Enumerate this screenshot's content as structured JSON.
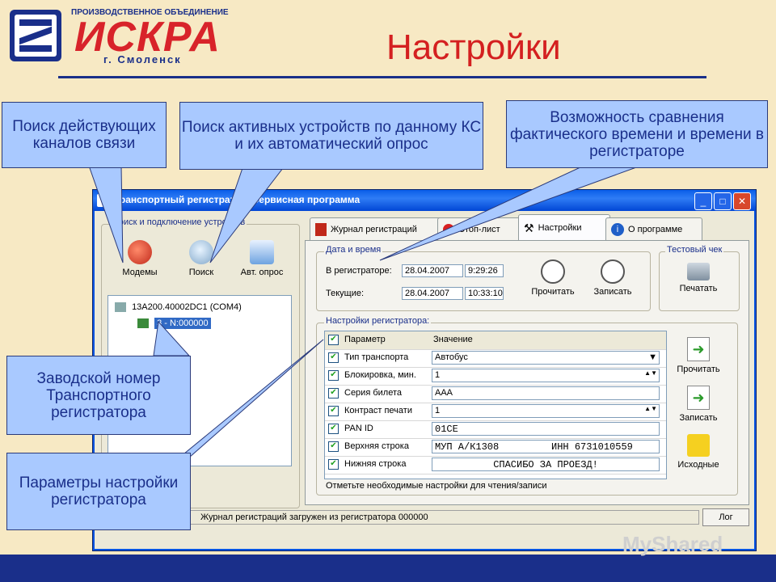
{
  "header": {
    "brand_top": "ПРОИЗВОДСТВЕННОЕ ОБЪЕДИНЕНИЕ",
    "brand": "ИСКРА",
    "brand_city": "г. Смоленск",
    "page_title": "Настройки"
  },
  "callouts": {
    "search_channels": "Поиск действующих каналов связи",
    "search_devices": "Поиск активных устройств по данному КС и их автоматический опрос",
    "time_compare": "Возможность сравнения фактического времени и времени в регистраторе",
    "serial_number": "Заводской номер Транспортного регистратора",
    "params": "Параметры настройки регистратора"
  },
  "window": {
    "title": "Транспортный регистратор. Сервисная программа",
    "left_group_label": "Поиск и подключение устройств",
    "tools": [
      "Модемы",
      "Поиск",
      "Авт. опрос"
    ],
    "tree": {
      "root": "13A200.40002DC1 (COM4)",
      "child": "3 - N:000000"
    },
    "tabs": [
      "Журнал регистраций",
      "Стоп-лист",
      "Настройки",
      "О программе"
    ],
    "datetime": {
      "group_label": "Дата и время",
      "in_recorder_label": "В регистраторе:",
      "in_recorder_date": "28.04.2007",
      "in_recorder_time": "9:29:26",
      "current_label": "Текущие:",
      "current_date": "28.04.2007",
      "current_time": "10:33:10",
      "read_btn": "Прочитать",
      "write_btn": "Записать"
    },
    "test_check": {
      "group_label": "Тестовый чек",
      "print_btn": "Печатать"
    },
    "settings": {
      "group_label": "Настройки регистратора:",
      "col_param": "Параметр",
      "col_value": "Значение",
      "rows": [
        {
          "name": "Тип транспорта",
          "value": "Автобус"
        },
        {
          "name": "Блокировка, мин.",
          "value": "1"
        },
        {
          "name": "Серия билета",
          "value": "AAA"
        },
        {
          "name": "Контраст печати",
          "value": "1"
        },
        {
          "name": "PAN ID",
          "value": "01CE"
        },
        {
          "name": "Верхняя строка",
          "value": "МУП А/К1308         ИНН 6731010559"
        },
        {
          "name": "Нижняя строка",
          "value": "СПАСИБО ЗА ПРОЕЗД!"
        }
      ],
      "hint": "Отметьте необходимые настройки для чтения/записи"
    },
    "side_buttons": [
      "Прочитать",
      "Записать",
      "Исходные"
    ],
    "status": "Журнал регистраций загружен из регистратора 000000",
    "log_btn": "Лог"
  },
  "watermark": "MyShared"
}
